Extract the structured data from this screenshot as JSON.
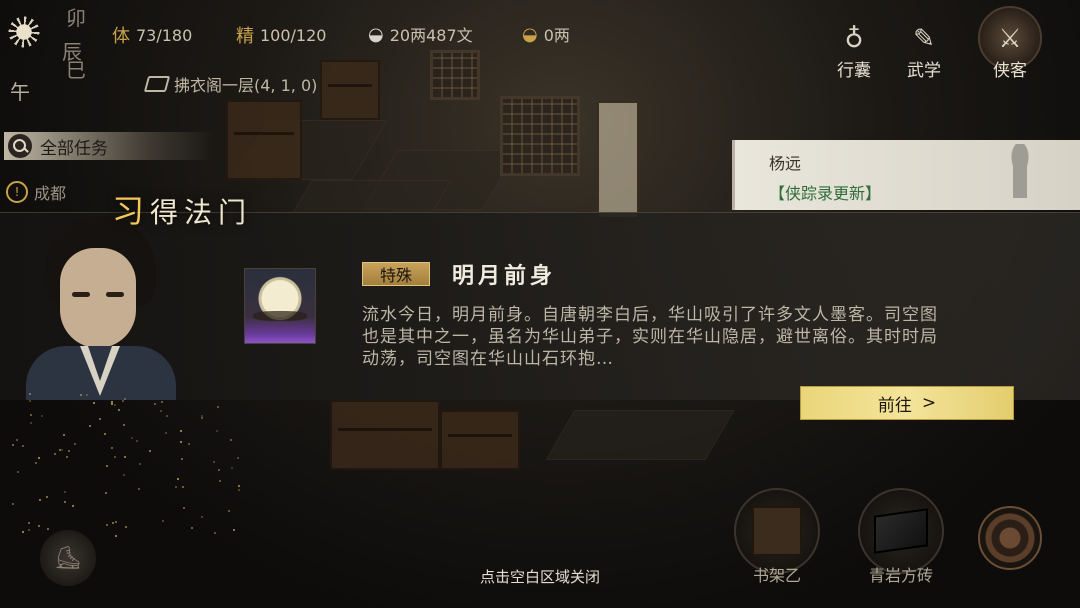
{
  "time": {
    "col1": [
      "卯",
      "巳"
    ],
    "col2": [
      "辰"
    ],
    "current": "午"
  },
  "stats": {
    "stamina_label": "体",
    "stamina_value": "73/180",
    "energy_label": "精",
    "energy_value": "100/120",
    "money_value": "20两487文",
    "gold_value": "0两"
  },
  "location": "拂衣阁一层(4, 1, 0)",
  "menu": {
    "bag": "行囊",
    "martial": "武学",
    "hero": "侠客"
  },
  "tasks": {
    "all_label": "全部任务",
    "current_label": "成都"
  },
  "notification": {
    "name": "杨远",
    "update": "【侠踪录更新】"
  },
  "banner": {
    "title_first": "习",
    "title_rest": "得法门",
    "tag": "特殊",
    "skill_name": "明月前身",
    "description": "流水今日，明月前身。自唐朝李白后，华山吸引了许多文人墨客。司空图也是其中之一，虽名为华山弟子，实则在华山隐居，避世离俗。其时时局动荡，司空图在华山山石环抱…",
    "goto_label": "前往",
    "goto_arrow": ">"
  },
  "bottom": {
    "close_hint": "点击空白区域关闭",
    "shelf_label": "书架乙",
    "brick_label": "青岩方砖"
  },
  "icons": {
    "weather": "sun-icon",
    "stamina": "stamina-icon",
    "energy": "energy-icon",
    "money": "silver-ingot-icon",
    "gold": "gold-ingot-icon",
    "search": "search-icon",
    "bag": "gourd-bag-icon",
    "martial": "scroll-icon",
    "compass": "compass-icon",
    "boot": "boot-icon"
  },
  "colors": {
    "accent_gold": "#f3c75a",
    "button_gold": "#f4e49a",
    "tag_gold": "#c9a25a",
    "update_green": "#2f6d3a",
    "skill_purple": "#8a55c8"
  }
}
